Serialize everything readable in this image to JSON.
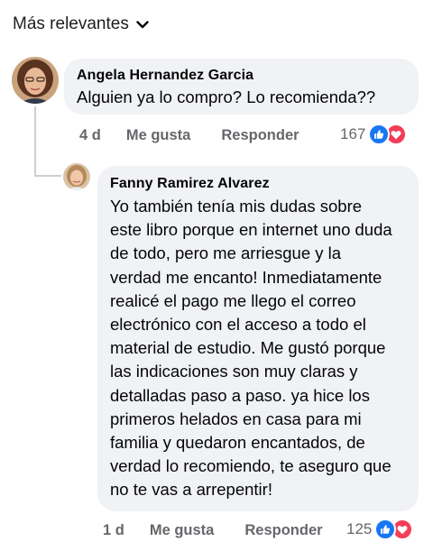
{
  "sort": {
    "label": "Más relevantes",
    "icon": "chevron-down-icon"
  },
  "comments": [
    {
      "author": "Angela Hernandez Garcia",
      "text": "Alguien ya lo compro? Lo recomienda??",
      "time": "4 d",
      "like_label": "Me gusta",
      "reply_label": "Responder",
      "reaction_count": "167",
      "reactions": [
        "like-icon",
        "love-icon"
      ]
    },
    {
      "author": "Fanny Ramirez Alvarez",
      "text_lines": [
        "Yo también tenía mis dudas sobre",
        "este libro porque en internet uno duda",
        "de todo, pero me arriesgue y la",
        "verdad me encanto! Inmediatamente",
        "realicé el pago me llego el correo",
        "electrónico con el acceso a todo el",
        "material de estudio. Me gustó porque",
        "las indicaciones son muy claras y",
        "detalladas paso a paso. ya hice los",
        "primeros helados en casa para mi",
        "familia y quedaron encantados, de",
        "verdad lo recomiendo, te aseguro que",
        "no te vas a arrepentir!"
      ],
      "time": "1 d",
      "like_label": "Me gusta",
      "reply_label": "Responder",
      "reaction_count": "125",
      "reactions": [
        "like-icon",
        "love-icon"
      ]
    }
  ],
  "colors": {
    "bubble": "#f0f2f5",
    "secondary_text": "#65676b",
    "like_blue": "#1877f2",
    "love_red": "#f33e58"
  }
}
